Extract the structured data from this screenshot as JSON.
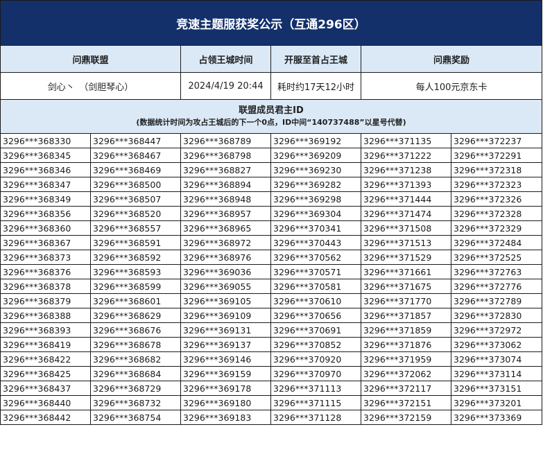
{
  "title": "竞速主题服获奖公示（互通296区）",
  "headers": {
    "alliance": "问鼎联盟",
    "capture_time": "占领王城时间",
    "server_to_capture": "开服至首占王城",
    "reward": "问鼎奖励"
  },
  "info": {
    "alliance": "剑心丶　（剑胆琴心）",
    "capture_time": "2024/4/19 20:44",
    "server_to_capture": "耗时约17天12小时",
    "reward": "每人100元京东卡"
  },
  "members": {
    "title": "联盟成员君主ID",
    "note": "(数据统计时间为攻占王城后的下一个0点，ID中间“140737488”以星号代替)"
  },
  "id_rows": [
    [
      "3296***368330",
      "3296***368447",
      "3296***368789",
      "3296***369192",
      "3296***371135",
      "3296***372237"
    ],
    [
      "3296***368345",
      "3296***368467",
      "3296***368798",
      "3296***369209",
      "3296***371222",
      "3296***372291"
    ],
    [
      "3296***368346",
      "3296***368469",
      "3296***368827",
      "3296***369230",
      "3296***371238",
      "3296***372318"
    ],
    [
      "3296***368347",
      "3296***368500",
      "3296***368894",
      "3296***369282",
      "3296***371393",
      "3296***372323"
    ],
    [
      "3296***368349",
      "3296***368507",
      "3296***368948",
      "3296***369298",
      "3296***371444",
      "3296***372326"
    ],
    [
      "3296***368356",
      "3296***368520",
      "3296***368957",
      "3296***369304",
      "3296***371474",
      "3296***372328"
    ],
    [
      "3296***368360",
      "3296***368557",
      "3296***368965",
      "3296***370341",
      "3296***371508",
      "3296***372329"
    ],
    [
      "3296***368367",
      "3296***368591",
      "3296***368972",
      "3296***370443",
      "3296***371513",
      "3296***372484"
    ],
    [
      "3296***368373",
      "3296***368592",
      "3296***368976",
      "3296***370562",
      "3296***371529",
      "3296***372525"
    ],
    [
      "3296***368376",
      "3296***368593",
      "3296***369036",
      "3296***370571",
      "3296***371661",
      "3296***372763"
    ],
    [
      "3296***368378",
      "3296***368599",
      "3296***369055",
      "3296***370581",
      "3296***371675",
      "3296***372776"
    ],
    [
      "3296***368379",
      "3296***368601",
      "3296***369105",
      "3296***370610",
      "3296***371770",
      "3296***372789"
    ],
    [
      "3296***368388",
      "3296***368629",
      "3296***369109",
      "3296***370656",
      "3296***371857",
      "3296***372830"
    ],
    [
      "3296***368393",
      "3296***368676",
      "3296***369131",
      "3296***370691",
      "3296***371859",
      "3296***372972"
    ],
    [
      "3296***368419",
      "3296***368678",
      "3296***369137",
      "3296***370852",
      "3296***371876",
      "3296***373062"
    ],
    [
      "3296***368422",
      "3296***368682",
      "3296***369146",
      "3296***370920",
      "3296***371959",
      "3296***373074"
    ],
    [
      "3296***368425",
      "3296***368684",
      "3296***369159",
      "3296***370970",
      "3296***372062",
      "3296***373114"
    ],
    [
      "3296***368437",
      "3296***368729",
      "3296***369178",
      "3296***371113",
      "3296***372117",
      "3296***373151"
    ],
    [
      "3296***368440",
      "3296***368732",
      "3296***369180",
      "3296***371115",
      "3296***372151",
      "3296***373201"
    ],
    [
      "3296***368442",
      "3296***368754",
      "3296***369183",
      "3296***371128",
      "3296***372159",
      "3296***373369"
    ]
  ],
  "colors": {
    "title_bg": "#14306b",
    "header_bg": "#dbe9f7",
    "border": "#1a1a1a"
  }
}
